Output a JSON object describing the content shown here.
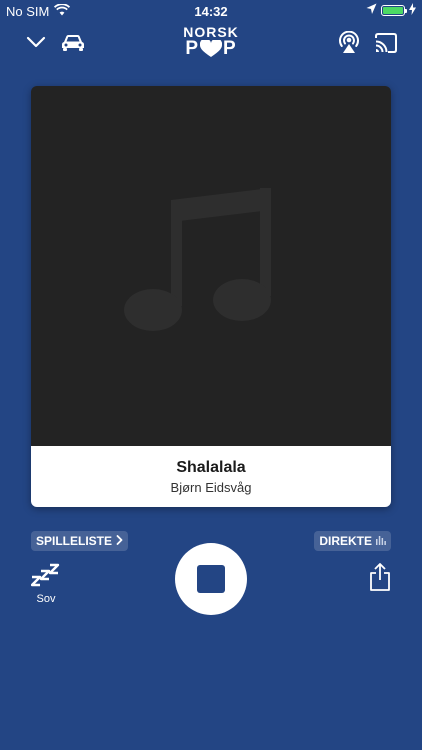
{
  "status_bar": {
    "carrier": "No SIM",
    "time": "14:32",
    "battery_color": "#4cd964"
  },
  "header": {
    "logo_line1": "NORSK",
    "logo_line2_left": "P",
    "logo_line2_right": "P",
    "icons": [
      "chevron-down-icon",
      "car-icon",
      "airplay-icon",
      "cast-icon"
    ]
  },
  "now_playing": {
    "title": "Shalalala",
    "artist": "Bjørn Eidsvåg"
  },
  "controls": {
    "playlist_label": "SPILLELISTE",
    "live_label": "DIREKTE",
    "sleep_glyph": "ZZZ",
    "sleep_label": "Sov"
  },
  "colors": {
    "background": "#234584",
    "artwork_bg": "#232323",
    "music_note": "#2e2e2e"
  }
}
